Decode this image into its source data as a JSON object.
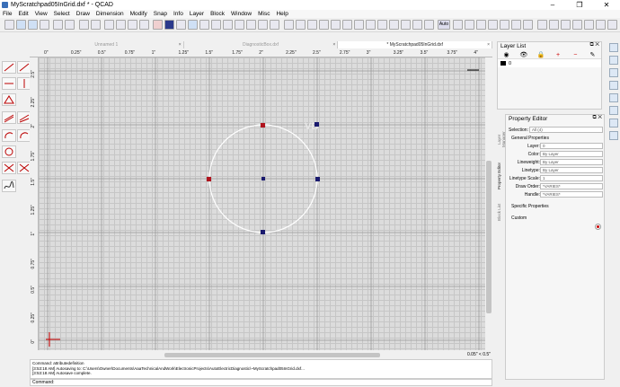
{
  "window": {
    "title": "MyScratchpad05InGrid.dxf * - QCAD",
    "buttons": [
      "–",
      "❐",
      "✕"
    ]
  },
  "menu": [
    "File",
    "Edit",
    "View",
    "Select",
    "Draw",
    "Dimension",
    "Modify",
    "Snap",
    "Info",
    "Layer",
    "Block",
    "Window",
    "Misc",
    "Help"
  ],
  "toolbar": {
    "auto_label": "Auto"
  },
  "tabs": [
    {
      "label": "Unnamed 1",
      "active": false
    },
    {
      "label": "DiagnosticBox.dxf",
      "active": false
    },
    {
      "label": "* MyScratchpad05InGrid.dxf",
      "active": true
    }
  ],
  "ruler": {
    "top": [
      "0\"",
      "0.25\"",
      "0.5\"",
      "0.75\"",
      "1\"",
      "1.25\"",
      "1.5\"",
      "1.75\"",
      "2\"",
      "2.25\"",
      "2.5\"",
      "2.75\"",
      "3\"",
      "3.25\"",
      "3.5\"",
      "3.75\"",
      "4\""
    ],
    "left": [
      "2.5\"",
      "2.25\"",
      "2\"",
      "1.75\"",
      "1.5\"",
      "1.25\"",
      "1\"",
      "0.75\"",
      "0.5\"",
      "0.25\"",
      "0\""
    ]
  },
  "canvas": {
    "ghost_text": "VB",
    "circle_color": "#ffffff",
    "grip_red": "#b0141e",
    "grip_blue": "#1a1a6e"
  },
  "status": {
    "coords": "0.05\" < 0.5\""
  },
  "command_output": [
    "Command: attributedefinition",
    "[3:53:18 AM] Autosaving to: C:\\Users\\Owner\\Documents\\AaaTechnicalAndWork\\ElectronicProjects\\AutoElectricDiagnostic\\~MyScratchpad05InGrid.dxf...",
    "[3:53:18 AM] Autosave complete."
  ],
  "command_prompt": "Command:",
  "layer_list": {
    "title": "Layer List",
    "buttons": [
      "◉",
      "👁",
      "🔒",
      "+",
      "−",
      "✎"
    ],
    "layers": [
      {
        "name": "0"
      }
    ]
  },
  "property_editor": {
    "title": "Property Editor",
    "selection_label": "Selection:",
    "selection_value": "All (4)",
    "general_header": "General Properties",
    "rows": [
      {
        "label": "Layer:",
        "value": "0"
      },
      {
        "label": "Color:",
        "value": "By Layer"
      },
      {
        "label": "Lineweight:",
        "value": "By Layer"
      },
      {
        "label": "Linetype:",
        "value": "By Layer"
      },
      {
        "label": "Linetype Scale:",
        "value": "1"
      },
      {
        "label": "Draw Order:",
        "value": "*VARIES*"
      },
      {
        "label": "Handle:",
        "value": "*VARIES*"
      }
    ],
    "specific_header": "Specific Properties",
    "custom_header": "Custom"
  },
  "side_tabs": [
    "Layer Manager",
    "Property Editor",
    "Block List"
  ]
}
